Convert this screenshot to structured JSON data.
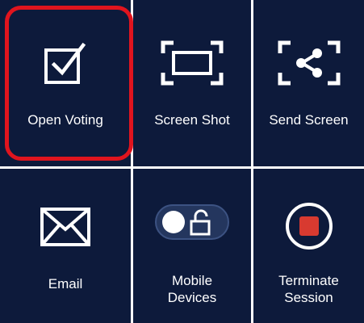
{
  "accent_color": "#e0141e",
  "tile_background": "#0d1a3b",
  "tiles": [
    {
      "label": "Open Voting",
      "icon": "checkbox-icon",
      "selected": true
    },
    {
      "label": "Screen Shot",
      "icon": "screenshot-frame-icon"
    },
    {
      "label": "Send Screen",
      "icon": "share-icon"
    },
    {
      "label": "Email",
      "icon": "envelope-icon"
    },
    {
      "label": "Mobile\nDevices",
      "icon": "lock-toggle-icon"
    },
    {
      "label": "Terminate\nSession",
      "icon": "stop-record-icon"
    }
  ]
}
